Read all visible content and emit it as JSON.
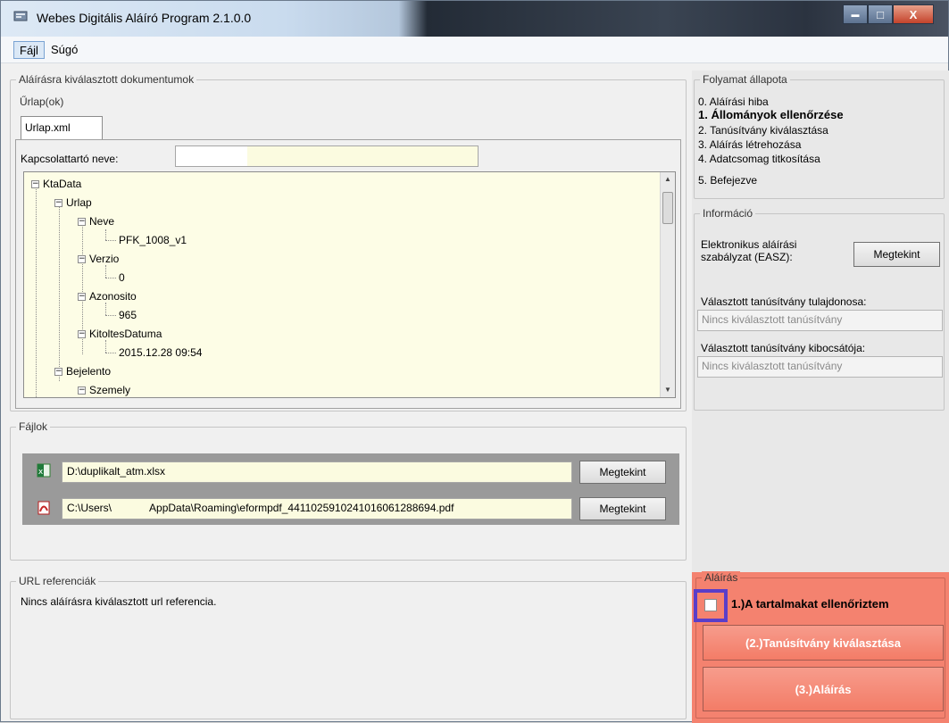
{
  "window": {
    "title": "Webes Digitális Aláíró Program 2.1.0.0",
    "minimize_glyph": "▬",
    "maximize_glyph": "□",
    "close_glyph": "X"
  },
  "menu": {
    "items": [
      "Fájl",
      "Súgó"
    ],
    "active": "Fájl"
  },
  "documents": {
    "legend": "Aláírásra kiválasztott dokumentumok",
    "forms_legend": "Űrlap(ok)",
    "tab_label": "Urlap.xml",
    "contact_label": "Kapcsolattartó neve:",
    "contact_value": "",
    "tree": [
      "KtaData",
      "Urlap",
      "Neve",
      "PFK_1008_v1",
      "Verzio",
      "0",
      "Azonosito",
      "965",
      "KitoltesDatuma",
      "2015.12.28 09:54",
      "Bejelento",
      "Szemely"
    ]
  },
  "files": {
    "legend": "Fájlok",
    "items": [
      {
        "path": "D:\\duplikalt_atm.xlsx",
        "icon": "excel-icon",
        "button": "Megtekint"
      },
      {
        "path_prefix": "C:\\Users\\",
        "path_suffix": "AppData\\Roaming\\eformpdf_4411025910241016061288694.pdf",
        "icon": "pdf-icon",
        "button": "Megtekint"
      }
    ]
  },
  "urls": {
    "legend": "URL referenciák",
    "message": "Nincs aláírásra kiválasztott url referencia."
  },
  "process": {
    "legend": "Folyamat állapota",
    "steps": [
      "0. Aláírási hiba",
      "1. Állományok ellenőrzése",
      "2. Tanúsítvány kiválasztása",
      "3. Aláírás létrehozása",
      "4. Adatcsomag titkosítása",
      "5. Befejezve"
    ],
    "current_step": 1
  },
  "info": {
    "legend": "Információ",
    "easz_label_line1": "Elektronikus aláírási",
    "easz_label_line2": "szabályzat (EASZ):",
    "easz_button": "Megtekint",
    "owner_label": "Választott tanúsítvány tulajdonosa:",
    "owner_value": "Nincs kiválasztott tanúsítvány",
    "issuer_label": "Választott tanúsítvány kibocsátója:",
    "issuer_value": "Nincs kiválasztott tanúsítvány"
  },
  "signing": {
    "legend": "Aláírás",
    "checkbox_label": "1.)A tartalmakat ellenőriztem",
    "checkbox_checked": false,
    "cert_button": "(2.)Tanúsítvány kiválasztása",
    "sign_button": "(3.)Aláírás",
    "accent_color": "#f4826f",
    "highlight_color": "#5a3ec8"
  }
}
